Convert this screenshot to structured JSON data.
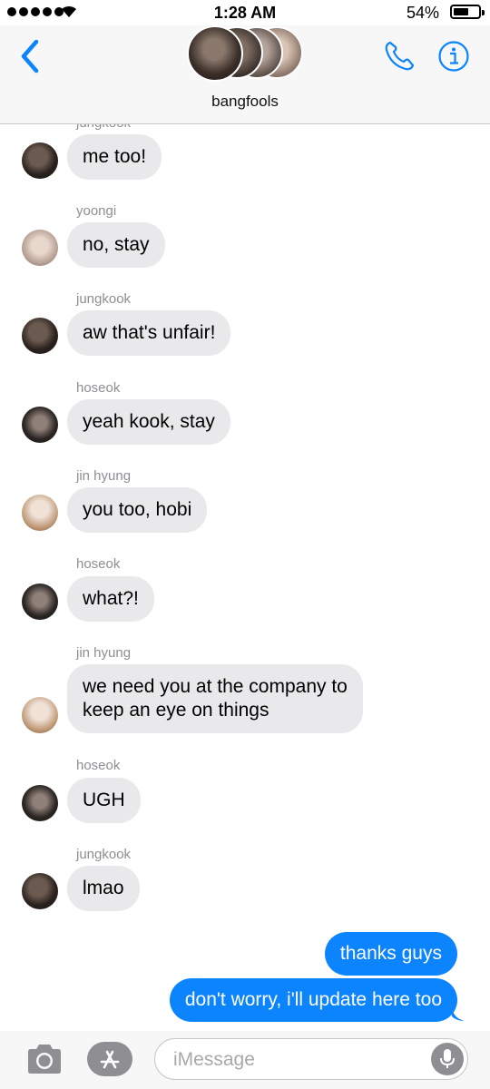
{
  "status_bar": {
    "time": "1:28 AM",
    "battery": "54%"
  },
  "header": {
    "group_name": "bangfools"
  },
  "partial_sender": "jungkook",
  "messages": [
    {
      "sender": "",
      "text": "me too!",
      "avatar": "jungkook"
    },
    {
      "sender": "yoongi",
      "text": "no, stay",
      "avatar": "yoongi"
    },
    {
      "sender": "jungkook",
      "text": "aw that's unfair!",
      "avatar": "jungkook"
    },
    {
      "sender": "hoseok",
      "text": "yeah kook, stay",
      "avatar": "hoseok"
    },
    {
      "sender": "jin hyung",
      "text": "you too, hobi",
      "avatar": "jin"
    },
    {
      "sender": "hoseok",
      "text": "what?!",
      "avatar": "hoseok"
    },
    {
      "sender": "jin hyung",
      "text_line1": "we need you at the company to",
      "text_line2": "keep an eye on things",
      "avatar": "jin"
    },
    {
      "sender": "hoseok",
      "text": "UGH",
      "avatar": "hoseok"
    },
    {
      "sender": "jungkook",
      "text": "lmao",
      "avatar": "jungkook"
    }
  ],
  "outgoing": [
    {
      "text": "thanks guys"
    },
    {
      "text": "don't worry, i'll update here too"
    }
  ],
  "input": {
    "placeholder": "iMessage"
  },
  "colors": {
    "accent": "#0b84fe",
    "incoming_bubble": "#e9e9eb",
    "outgoing_bubble": "#0b84fe"
  }
}
